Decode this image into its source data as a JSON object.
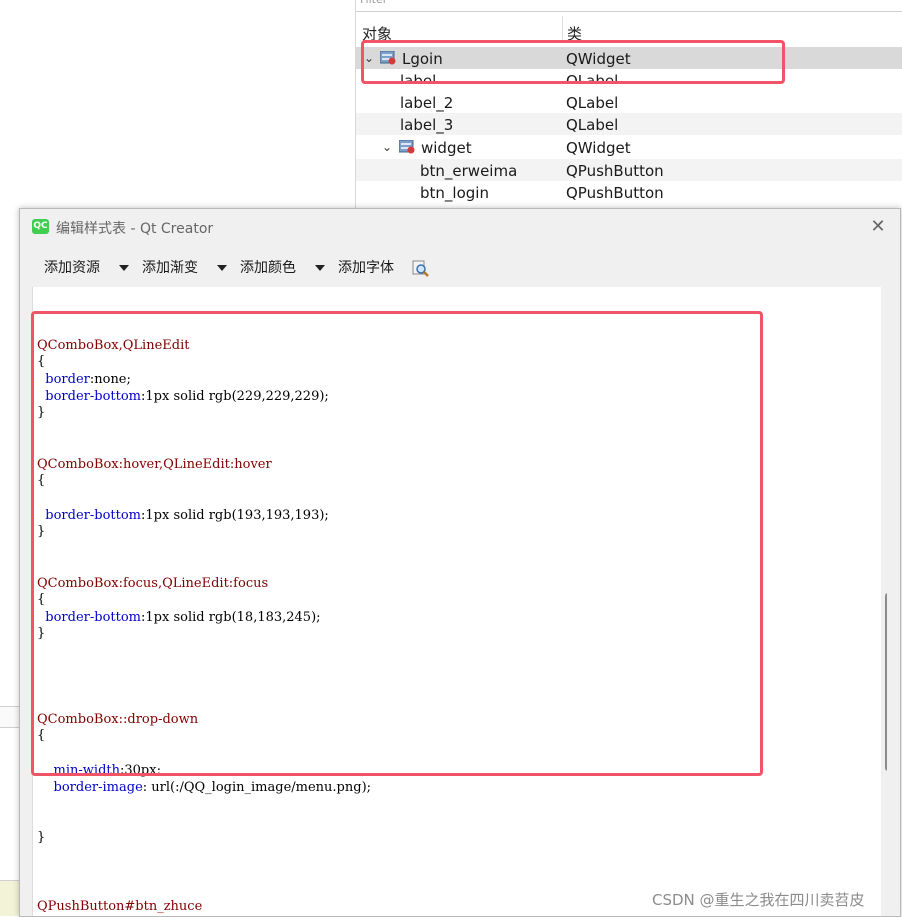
{
  "inspector": {
    "filter_placeholder": "Filter",
    "col_object": "对象",
    "col_class": "类",
    "rows": [
      {
        "name": "Lgoin",
        "cls": "QWidget"
      },
      {
        "name": "label",
        "cls": "QLabel"
      },
      {
        "name": "label_2",
        "cls": "QLabel"
      },
      {
        "name": "label_3",
        "cls": "QLabel"
      },
      {
        "name": "widget",
        "cls": "QWidget"
      },
      {
        "name": "btn_erweima",
        "cls": "QPushButton"
      },
      {
        "name": "btn_login",
        "cls": "QPushButton"
      }
    ]
  },
  "dialog": {
    "app_icon": "QC",
    "title": "编辑样式表 - Qt Creator",
    "toolbar": {
      "add_resource": "添加资源",
      "add_gradient": "添加渐变",
      "add_color": "添加颜色",
      "add_font": "添加字体"
    }
  },
  "code": {
    "l1_sel": "QComboBox,QLineEdit",
    "l1_open": "{",
    "l1_p1": "border",
    "l1_v1": ":none;",
    "l1_p2": "border-bottom",
    "l1_v2": ":1px solid rgb(229,229,229);",
    "l1_close": "}",
    "l2_sel": "QComboBox:hover,QLineEdit:hover",
    "l2_open": "{",
    "l2_p1": "border-bottom",
    "l2_v1": ":1px solid rgb(193,193,193);",
    "l2_close": "}",
    "l3_sel": "QComboBox:focus,QLineEdit:focus",
    "l3_open": "{",
    "l3_p1": "border-bottom",
    "l3_v1": ":1px solid rgb(18,183,245);",
    "l3_close": "}",
    "l4_sel": "QComboBox::drop-down",
    "l4_open": "{",
    "l4_p1": "min-width",
    "l4_v1": ":30px;",
    "l4_p2": "border-image",
    "l4_v2": ": url(:/QQ_login_image/menu.png);",
    "l4_close": "}",
    "l5_sel": "QPushButton#btn_zhuce"
  },
  "watermark": "CSDN @重生之我在四川卖苕皮",
  "colors": {
    "highlight": "#f25467",
    "selector": "#800000",
    "property": "#0000cc"
  }
}
